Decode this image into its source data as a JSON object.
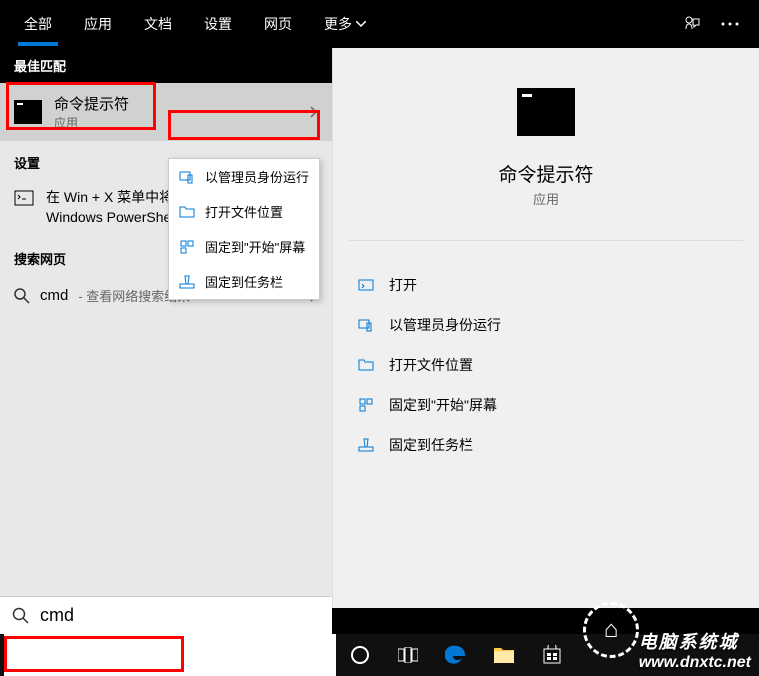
{
  "header": {
    "tabs": [
      "全部",
      "应用",
      "文档",
      "设置",
      "网页"
    ],
    "more_label": "更多"
  },
  "left": {
    "best_match_header": "最佳匹配",
    "result": {
      "name": "命令提示符",
      "type": "应用"
    },
    "settings_header": "设置",
    "settings_item": "在 Win + X 菜单中将命令提示符替换为 Windows PowerShell",
    "websearch_header": "搜索网页",
    "websearch_query": "cmd",
    "websearch_hint": " - 查看网络搜索结果"
  },
  "context_menu": {
    "run_admin": "以管理员身份运行",
    "open_location": "打开文件位置",
    "pin_start": "固定到\"开始\"屏幕",
    "pin_taskbar": "固定到任务栏"
  },
  "right": {
    "title": "命令提示符",
    "subtitle": "应用",
    "actions": {
      "open": "打开",
      "run_admin": "以管理员身份运行",
      "open_location": "打开文件位置",
      "pin_start": "固定到\"开始\"屏幕",
      "pin_taskbar": "固定到任务栏"
    }
  },
  "search": {
    "value": "cmd"
  },
  "watermark": {
    "cn": "电脑系统城",
    "url": "www.dnxtc.net"
  }
}
